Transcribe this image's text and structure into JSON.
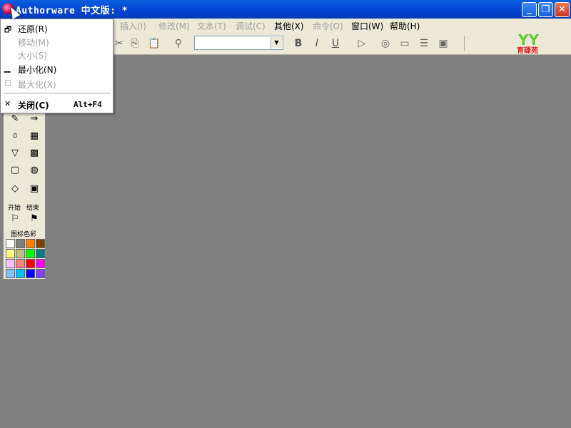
{
  "window": {
    "title": "Authorware 中文版: *",
    "minimize_label": "_",
    "maximize_label": "❐",
    "close_label": "✕"
  },
  "menubar": {
    "items": [
      {
        "label": "插入(I)",
        "enabled": false
      },
      {
        "label": "修改(M)",
        "enabled": false
      },
      {
        "label": "文本(T)",
        "enabled": false
      },
      {
        "label": "调试(C)",
        "enabled": false
      },
      {
        "label": "其他(X)",
        "enabled": true
      },
      {
        "label": "命令(O)",
        "enabled": false
      },
      {
        "label": "窗口(W)",
        "enabled": true
      },
      {
        "label": "帮助(H)",
        "enabled": true
      }
    ]
  },
  "toolbar": {
    "font_select_value": "",
    "bold_label": "B",
    "italic_label": "I",
    "underline_label": "U",
    "logo_text": "YY",
    "logo_caption": "育碟苑"
  },
  "system_menu": {
    "items": [
      {
        "icon": "restore-icon",
        "glyph": "🗗",
        "label": "还原(R)",
        "enabled": true
      },
      {
        "icon": "",
        "glyph": "",
        "label": "移动(M)",
        "enabled": false
      },
      {
        "icon": "",
        "glyph": "",
        "label": "大小(S)",
        "enabled": false
      },
      {
        "icon": "minimize-icon",
        "glyph": "▁",
        "label": "最小化(N)",
        "enabled": true
      },
      {
        "icon": "maximize-icon",
        "glyph": "☐",
        "label": "最大化(X)",
        "enabled": false
      },
      {
        "icon": "close-icon",
        "glyph": "✕",
        "label": "关闭(C)",
        "enabled": true,
        "shortcut": "Alt+F4"
      }
    ]
  },
  "icon_palette": {
    "start_label": "开始",
    "end_label": "结束",
    "color_label": "图标色彩",
    "colors": [
      "#ffffff",
      "#808080",
      "#ff8000",
      "#804000",
      "#ffff80",
      "#c0c080",
      "#00ff00",
      "#008080",
      "#ffc0ff",
      "#ff8080",
      "#ff0000",
      "#ff00ff",
      "#80c0ff",
      "#00c0ff",
      "#0000ff",
      "#8040ff"
    ]
  }
}
